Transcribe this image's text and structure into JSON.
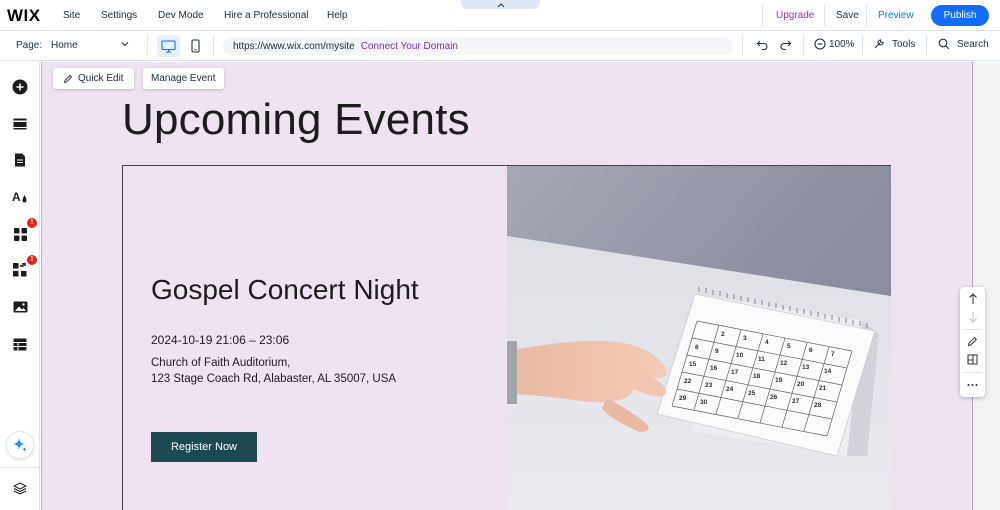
{
  "topbar": {
    "logo": "WIX",
    "menu": [
      "Site",
      "Settings",
      "Dev Mode",
      "Hire a Professional",
      "Help"
    ],
    "collapse_icon": "chevron-up-icon",
    "upgrade": "Upgrade",
    "save": "Save",
    "preview": "Preview",
    "publish": "Publish"
  },
  "secondbar": {
    "page_label": "Page:",
    "page_value": "Home",
    "url": "https://www.wix.com/mysite",
    "connect_domain": "Connect Your Domain",
    "zoom": "100%",
    "tools": "Tools",
    "search": "Search"
  },
  "leftrail": {
    "items": [
      {
        "icon": "add-elements-icon"
      },
      {
        "icon": "sections-icon"
      },
      {
        "icon": "pages-icon"
      },
      {
        "icon": "site-design-icon"
      },
      {
        "icon": "apps-icon",
        "badge": "1"
      },
      {
        "icon": "business-apps-icon",
        "badge": "1"
      },
      {
        "icon": "media-icon"
      },
      {
        "icon": "cms-icon"
      }
    ],
    "ai_icon": "ai-sparkle-icon",
    "layers_icon": "layers-icon"
  },
  "canvas": {
    "quick_edit": "Quick Edit",
    "manage_event": "Manage Event",
    "heading": "Upcoming Events",
    "event": {
      "title": "Gospel Concert Night",
      "datetime": "2024-10-19 21:06 – 23:06",
      "venue": "Church of Faith Auditorium,",
      "address": "123 Stage Coach Rd, Alabaster, AL 35007, USA",
      "register": "Register Now"
    }
  },
  "colors": {
    "accent": "#116dff",
    "upgrade": "#9a27d5",
    "canvas_bg": "#efe3f1",
    "register_button": "#1d4a52",
    "badge": "#e62214"
  }
}
